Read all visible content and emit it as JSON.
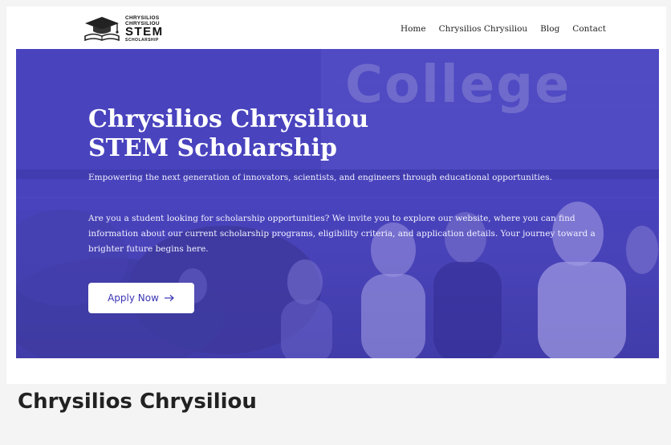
{
  "brand": {
    "logo_line1": "CHRYSILIOS",
    "logo_line2": "CHRYSILIOU",
    "logo_line3": "STEM",
    "logo_line4": "SCHOLARSHIP"
  },
  "nav": {
    "items": [
      {
        "label": "Home"
      },
      {
        "label": "Chrysilios Chrysiliou"
      },
      {
        "label": "Blog"
      },
      {
        "label": "Contact"
      }
    ]
  },
  "hero": {
    "sign_text": "College",
    "title_line1": "Chrysilios Chrysiliou",
    "title_line2": "STEM Scholarship",
    "subtitle": "Empowering the next generation of innovators, scientists, and engineers through educational opportunities.",
    "body": "Are you a student looking for scholarship opportunities? We invite you to explore our website, where you can find information about our current scholarship programs, eligibility criteria, and application details. Your journey toward a brighter future begins here.",
    "cta_label": "Apply Now",
    "cta_icon": "arrow-right-icon"
  },
  "section": {
    "heading": "Chrysilios Chrysiliou"
  },
  "colors": {
    "hero_overlay": "#4a45b4",
    "cta_text": "#3b35b5",
    "page_bg": "#f4f4f4"
  }
}
